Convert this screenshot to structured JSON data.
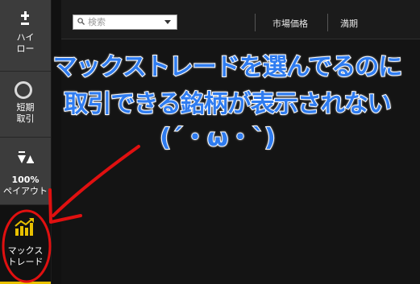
{
  "sidebar": {
    "items": [
      {
        "label_line1": "ハイ",
        "label_line2": "ロー",
        "icon": "plus-minus-icon"
      },
      {
        "label_line1": "短期",
        "label_line2": "取引",
        "icon": "clock-icon"
      },
      {
        "label_line1": "100%",
        "label_line2": "ペイアウト",
        "icon": "triangles-icon"
      },
      {
        "label_line1": "マックス",
        "label_line2": "トレード",
        "icon": "bar-chart-arrow-icon",
        "active": true
      }
    ],
    "active_color": "#e8c000"
  },
  "toolbar": {
    "search_placeholder": "検索",
    "columns": [
      "市場価格",
      "満期"
    ]
  },
  "annotation": {
    "line1": "マックストレードを選んでるのに",
    "line2": "取引できる銘柄が表示されない",
    "line3": "(´・ω・`)",
    "text_color": "#2f7cf0",
    "marker_color": "#e01010"
  }
}
